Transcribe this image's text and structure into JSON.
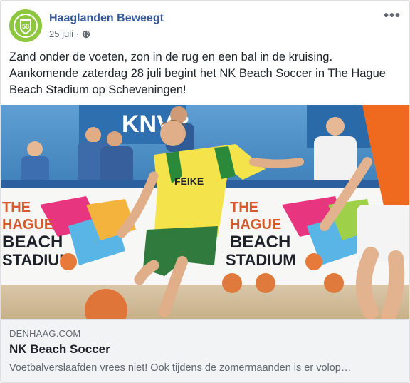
{
  "post": {
    "page_name": "Haaglanden Beweegt",
    "date": "25 juli",
    "separator": "·",
    "privacy_icon": "globe-icon",
    "more_icon": "more-options-icon",
    "more_label": "•••",
    "text": "Zand onder de voeten, zon in de rug en een bal in de kruising. Aankomende zaterdag 28 juli begint het NK Beach Soccer in The Hague Beach Stadium op Scheveningen!"
  },
  "media": {
    "banner_left": "THE\nHAGUE\nBEACH\nSTADIUM",
    "banner_right": "THE\nHAGUE\nBEACH\nSTADIUM",
    "sponsor_top": "KNVB",
    "jersey_text": "FEIKE"
  },
  "link": {
    "domain": "DENHAAG.COM",
    "title": "NK Beach Soccer",
    "description": "Voetbalverslaafden vrees niet! Ook tijdens de zomermaanden is er volop…"
  },
  "colors": {
    "brand_green": "#8dc63f",
    "link_blue": "#365899"
  }
}
